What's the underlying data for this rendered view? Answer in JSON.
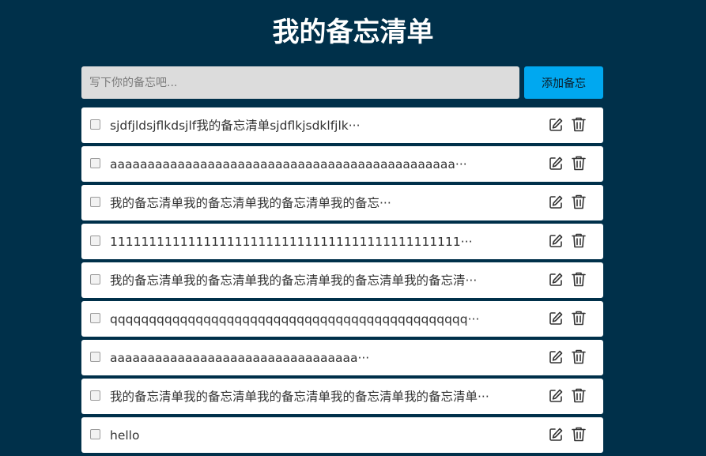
{
  "header": {
    "title": "我的备忘清单"
  },
  "form": {
    "placeholder": "写下你的备忘吧...",
    "add_label": "添加备忘"
  },
  "memos": [
    {
      "text": "sjdfjldsjflkdsjlf我的备忘清单sjdflkjsdklfjlk···"
    },
    {
      "text": "aaaaaaaaaaaaaaaaaaaaaaaaaaaaaaaaaaaaaaaaaaaaaa···"
    },
    {
      "text": "我的备忘清单我的备忘清单我的备忘清单我的备忘···"
    },
    {
      "text": "111111111111111111111111111111111111111111111···"
    },
    {
      "text": "我的备忘清单我的备忘清单我的备忘清单我的备忘清单我的备忘清···"
    },
    {
      "text": "qqqqqqqqqqqqqqqqqqqqqqqqqqqqqqqqqqqqqqqqqqqqqq···"
    },
    {
      "text": "aaaaaaaaaaaaaaaaaaaaaaaaaaaaaaaaa···"
    },
    {
      "text": "我的备忘清单我的备忘清单我的备忘清单我的备忘清单我的备忘清单···"
    },
    {
      "text": "hello"
    }
  ],
  "icons": {
    "edit": "edit-icon",
    "delete": "trash-icon"
  }
}
